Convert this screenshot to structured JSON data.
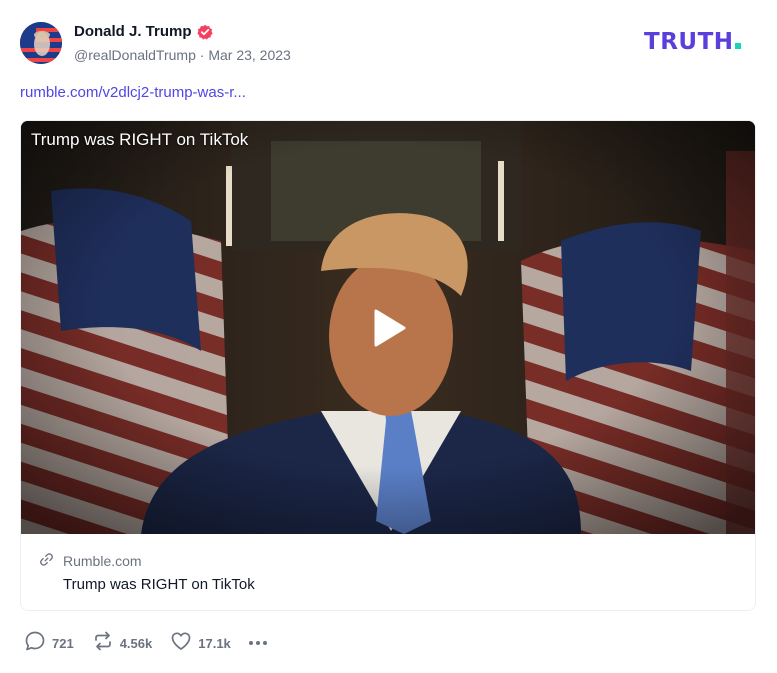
{
  "post": {
    "author": {
      "name": "Donald J. Trump",
      "handle": "@realDonaldTrump",
      "separator": "·",
      "date": "Mar 23, 2023",
      "verified": true
    },
    "brand": "TRUTH",
    "link_text": "rumble.com/v2dlcj2-trump-was-r...",
    "link_color": "#4f46e5"
  },
  "card": {
    "video_title": "Trump was RIGHT on TikTok",
    "source": "Rumble.com",
    "title": "Trump was RIGHT on TikTok"
  },
  "actions": {
    "replies": "721",
    "retruths": "4.56k",
    "likes": "17.1k"
  },
  "icons": {
    "verified": "verified-badge-icon",
    "link": "link-icon",
    "reply": "reply-icon",
    "retruth": "retruth-icon",
    "like": "heart-icon",
    "more": "more-icon",
    "play": "play-icon"
  },
  "colors": {
    "brand_purple": "#5b3fdb",
    "brand_teal": "#18d4b8",
    "verified": "#f43f5e",
    "muted": "#6b7280"
  }
}
